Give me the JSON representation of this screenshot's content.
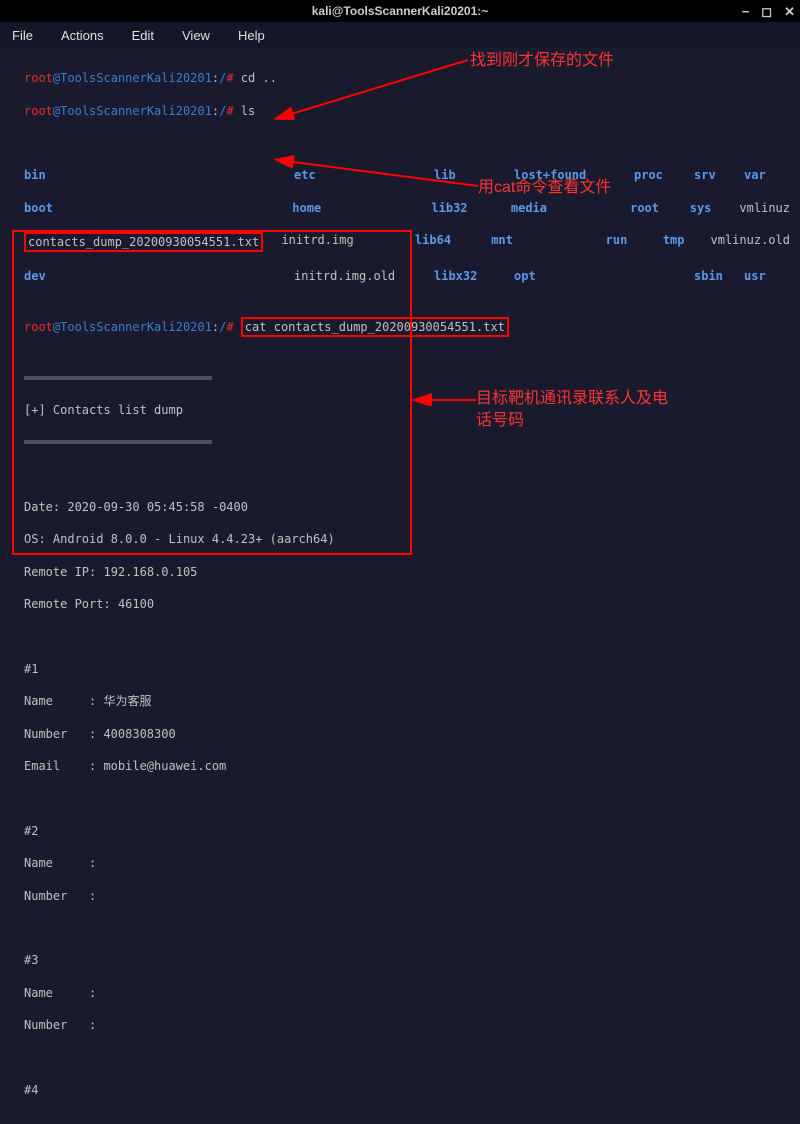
{
  "titlebar": {
    "title": "kali@ToolsScannerKali20201:~"
  },
  "window_controls": {
    "min": "−",
    "max": "◻",
    "close": "✕"
  },
  "menubar": [
    "File",
    "Actions",
    "Edit",
    "View",
    "Help"
  ],
  "prompt": {
    "root": "root",
    "at": "@",
    "host": "ToolsScannerKali20201",
    "path": ":/",
    "hash": "#"
  },
  "commands": {
    "cd": "cd ..",
    "ls": "ls",
    "cat": "cat",
    "dump_file": "contacts_dump_20200930054551.txt"
  },
  "ls_output": [
    [
      "bin",
      "etc",
      "lib",
      "lost+found",
      "proc",
      "srv",
      "var"
    ],
    [
      "boot",
      "home",
      "lib32",
      "media",
      "root",
      "sys",
      "vmlinuz"
    ],
    [
      "contacts_dump_20200930054551.txt",
      "initrd.img",
      "lib64",
      "mnt",
      "run",
      "tmp",
      "vmlinuz.old"
    ],
    [
      "dev",
      "initrd.img.old",
      "libx32",
      "opt",
      "",
      "sbin",
      "usr"
    ]
  ],
  "separator": "══════════════════════════",
  "header_line": "[+] Contacts list dump",
  "dump": {
    "date_label": "Date",
    "date_value": "2020-09-30 05:45:58 -0400",
    "os_label": "OS",
    "os_value": "Android 8.0.0 - Linux 4.4.23+ (aarch64)",
    "remote_ip_label": "Remote IP",
    "remote_ip_value": "192.168.0.105",
    "remote_port_label": "Remote Port",
    "remote_port_value": "46100"
  },
  "contacts": [
    {
      "id": "#1",
      "name_label": "Name",
      "name": "华为客服",
      "number_label": "Number",
      "number": "4008308300",
      "email_label": "Email",
      "email": "mobile@huawei.com"
    },
    {
      "id": "#2",
      "name_label": "Name",
      "name": "",
      "number_label": "Number",
      "number": ""
    },
    {
      "id": "#3",
      "name_label": "Name",
      "name": "",
      "number_label": "Number",
      "number": ""
    },
    {
      "id": "#4"
    }
  ],
  "annotations": {
    "find_file": "找到刚才保存的文件",
    "cat_cmd": "用cat命令查看文件",
    "contacts_info": "目标靶机通讯录联系人及电话号码"
  }
}
